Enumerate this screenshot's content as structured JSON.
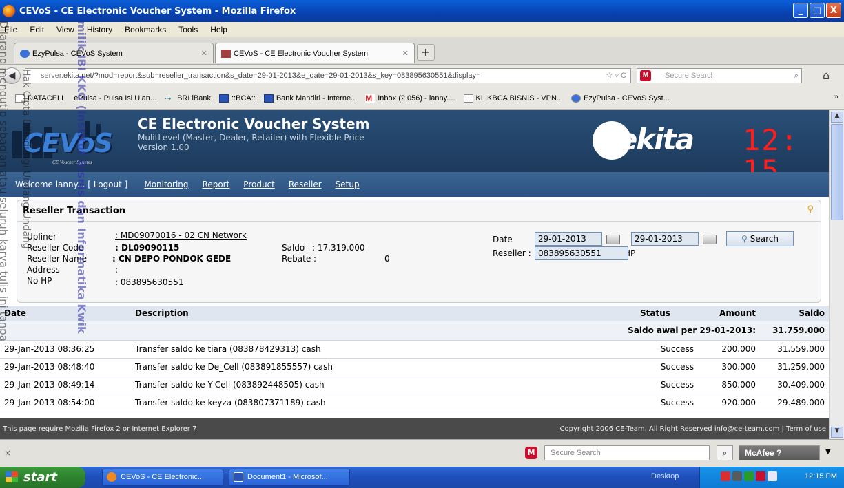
{
  "window": {
    "title": "CEVoS - CE Electronic Voucher System - Mozilla Firefox",
    "controls": [
      "_",
      "□",
      "X"
    ]
  },
  "menu": [
    "File",
    "Edit",
    "View",
    "History",
    "Bookmarks",
    "Tools",
    "Help"
  ],
  "tabs": [
    {
      "label": "EzyPulsa - CEVoS System",
      "active": false
    },
    {
      "label": "CEVoS - CE Electronic Voucher System",
      "active": true
    }
  ],
  "nav": {
    "url_prefix": "server.",
    "url": "ekita.net/?mod=report&sub=reseller_transaction&s_date=29-01-2013&e_date=29-01-2013&s_key=083895630551&display=",
    "search_placeholder": "Secure Search"
  },
  "bookmarks": [
    "DATACELL",
    "ePulsa - Pulsa Isi Ulan...",
    "BRI iBank",
    "::BCA::",
    "Bank Mandiri - Interne...",
    "Inbox (2,056) - lanny....",
    "KLIKBCA BISNIS - VPN...",
    "EzyPulsa - CEVoS Syst..."
  ],
  "bookmarks_more": "»",
  "site": {
    "logo_text": "CEVoS",
    "logo_sub": "CE Voucher Systems",
    "title": "CE Electronic Voucher System",
    "subtitle": "MulitLevel (Master, Dealer, Retailer) with Flexible Price",
    "version": "Version 1.00",
    "brand": "Cekita",
    "clock": "12: 15"
  },
  "sitenav": {
    "welcome": "Welcome lanny... [ Logout ]",
    "links": [
      "Monitoring",
      "Report",
      "Product",
      "Reseller",
      "Setup"
    ]
  },
  "panel": {
    "title": "Reseller Transaction",
    "upliner_label": "Upliner",
    "upliner_value": ": MD09070016 - 02 CN Network",
    "code_label": "Reseller Code",
    "code_value": ": DL09090115",
    "name_label": "Reseller Name",
    "name_value": ": CN DEPO PONDOK GEDE",
    "address_label": "Address",
    "address_value": ":",
    "hp_label": "No HP",
    "hp_value": ": 083895630551",
    "saldo_label": "Saldo",
    "saldo_value": ": 17.319.000",
    "rebate_label": "Rebate :",
    "rebate_value": "0",
    "date_label": "Date",
    "date_colon": ":",
    "date_from": "29-01-2013",
    "date_dash": "-",
    "date_to": "29-01-2013",
    "search_label": "Search",
    "reseller_label": "Reseller :",
    "reseller_value": "083895630551",
    "reseller_hint": "**ID/No HP"
  },
  "table": {
    "headers": {
      "date": "Date",
      "description": "Description",
      "status": "Status",
      "amount": "Amount",
      "saldo": "Saldo"
    },
    "saldo_awal_label": "Saldo awal per 29-01-2013:",
    "saldo_awal_value": "31.759.000",
    "rows": [
      {
        "date": "29-Jan-2013 08:36:25",
        "description": "Transfer saldo ke tiara (083878429313) cash",
        "status": "Success",
        "amount": "200.000",
        "saldo": "31.559.000"
      },
      {
        "date": "29-Jan-2013 08:48:40",
        "description": "Transfer saldo ke De_Cell (083891855557) cash",
        "status": "Success",
        "amount": "300.000",
        "saldo": "31.259.000"
      },
      {
        "date": "29-Jan-2013 08:49:14",
        "description": "Transfer saldo ke Y-Cell (083892448505) cash",
        "status": "Success",
        "amount": "850.000",
        "saldo": "30.409.000"
      },
      {
        "date": "29-Jan-2013 08:54:00",
        "description": "Transfer saldo ke keyza (083807371189) cash",
        "status": "Success",
        "amount": "920.000",
        "saldo": "29.489.000"
      }
    ]
  },
  "footer": {
    "left": "This page require Mozilla Firefox 2 or Internet Explorer 7",
    "right_prefix": "Copyright 2006 CE-Team. All Right Reserved",
    "email": "info@ce-team.com",
    "sep": "|",
    "terms": "Term of use"
  },
  "statusbar": {
    "close": "×",
    "search_placeholder": "Secure Search",
    "mcafee_label": "McAfee"
  },
  "taskbar": {
    "start": "start",
    "items": [
      "CEVoS - CE Electronic...",
      "Document1 - Microsof..."
    ],
    "desktop": "Desktop",
    "clock": "12:15 PM"
  },
  "watermark": {
    "line1": "Hak Cipta Dilindungi Undang-Undang",
    "line2": "Dilarang mengutip sebagian atau seluruh karya tulis ini tanpa",
    "line3": "milik IBI KKG (Institut Bisnis dan Informatika Kwik"
  },
  "colors": {
    "title_bar": "#0842b0",
    "site_header": "#1c3a5c",
    "site_nav": "#2b5282",
    "clock": "#ff1e1e",
    "footer": "#4a4a4a",
    "taskbar": "#1f4fbc",
    "start": "#2e822e"
  }
}
